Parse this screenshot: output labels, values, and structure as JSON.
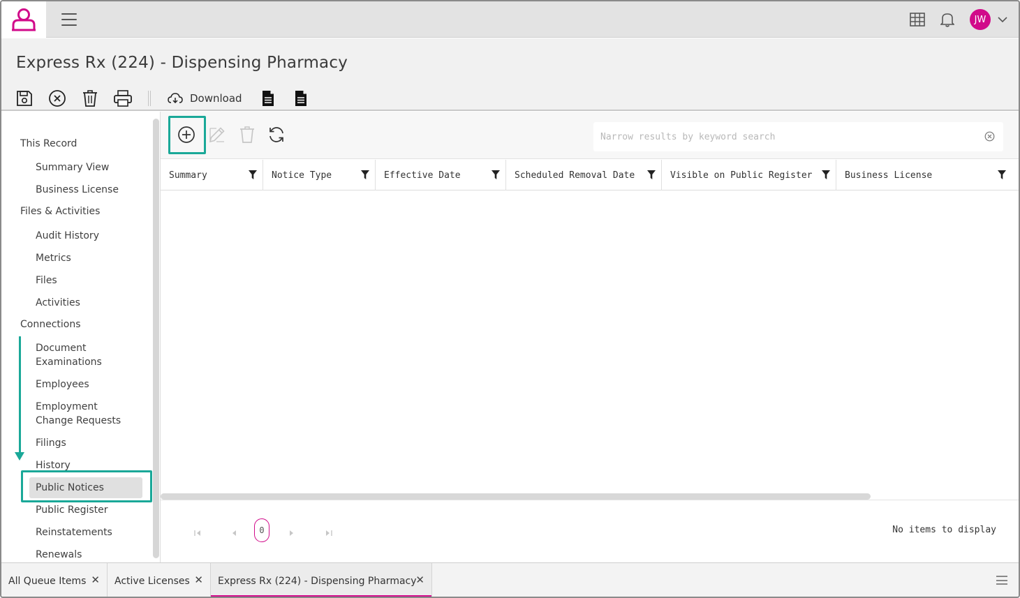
{
  "app": {
    "brand_color": "#d10a8a",
    "accent_color": "#1aa898",
    "user_initials": "JW"
  },
  "header": {
    "title": "Express Rx (224) - Dispensing Pharmacy",
    "toolbar": {
      "download_label": "Download"
    }
  },
  "sidebar": {
    "sections": [
      {
        "label": "This Record",
        "items": [
          "Summary View",
          "Business License"
        ]
      },
      {
        "label": "Files & Activities",
        "items": [
          "Audit History",
          "Metrics",
          "Files",
          "Activities"
        ]
      },
      {
        "label": "Connections",
        "items": [
          "Document Examinations",
          "Employees",
          "Employment Change Requests",
          "Filings",
          "History",
          "Public Notices",
          "Public Register",
          "Reinstatements",
          "Renewals"
        ]
      }
    ],
    "active_item": "Public Notices"
  },
  "grid": {
    "search": {
      "placeholder": "Narrow results by keyword search",
      "value": ""
    },
    "columns": [
      "Summary",
      "Notice Type",
      "Effective Date",
      "Scheduled Removal Date",
      "Visible on Public Register",
      "Business License"
    ],
    "rows": [],
    "pager": {
      "current_page": "0",
      "status": "No items to display"
    }
  },
  "bottom_tabs": [
    {
      "label": "All Queue Items",
      "active": false
    },
    {
      "label": "Active Licenses",
      "active": false
    },
    {
      "label": "Express Rx (224) - Dispensing Pharmacy",
      "active": true
    }
  ]
}
